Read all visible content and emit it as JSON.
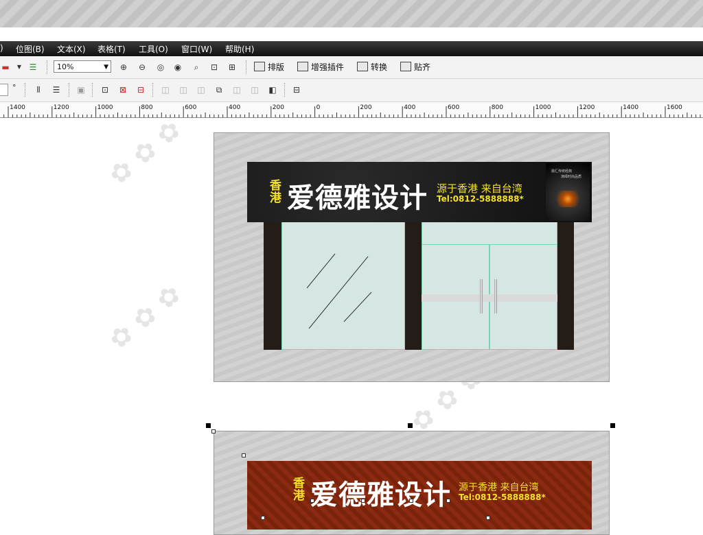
{
  "menu": {
    "items": [
      {
        "label": ")"
      },
      {
        "label": "位图(B)"
      },
      {
        "label": "文本(X)"
      },
      {
        "label": "表格(T)"
      },
      {
        "label": "工具(O)"
      },
      {
        "label": "窗口(W)"
      },
      {
        "label": "帮助(H)"
      }
    ]
  },
  "toolbar": {
    "zoom_value": "10%",
    "plugins": [
      {
        "label": "排版"
      },
      {
        "label": "增强插件"
      },
      {
        "label": "转换"
      },
      {
        "label": "贴齐"
      }
    ],
    "degree": "°"
  },
  "ruler": {
    "labels": [
      "1400",
      "1200",
      "1000",
      "800",
      "600",
      "400",
      "200",
      "0",
      "200",
      "400",
      "600",
      "800",
      "1000",
      "1200",
      "1400",
      "1600"
    ]
  },
  "sign1": {
    "xiang": "香",
    "gang": "港",
    "name": "爱德雅设计",
    "slogan": "源于香港 来自台湾",
    "tel": "Tel:0812-5888888*",
    "thumb_line1": "融汇传统经典",
    "thumb_line2": "演绎时尚品质"
  },
  "sign2": {
    "xiang": "香",
    "gang": "港",
    "name": "爱德雅设计",
    "slogan": "源于香港 来自台湾",
    "tel": "Tel:0812-5888888*"
  },
  "colors": {
    "accent_yellow": "#f5e12a",
    "sign_dark": "#111111",
    "sign_red": "#8a2a10",
    "glass": "#d6e7e3",
    "pillar": "#231c17"
  }
}
